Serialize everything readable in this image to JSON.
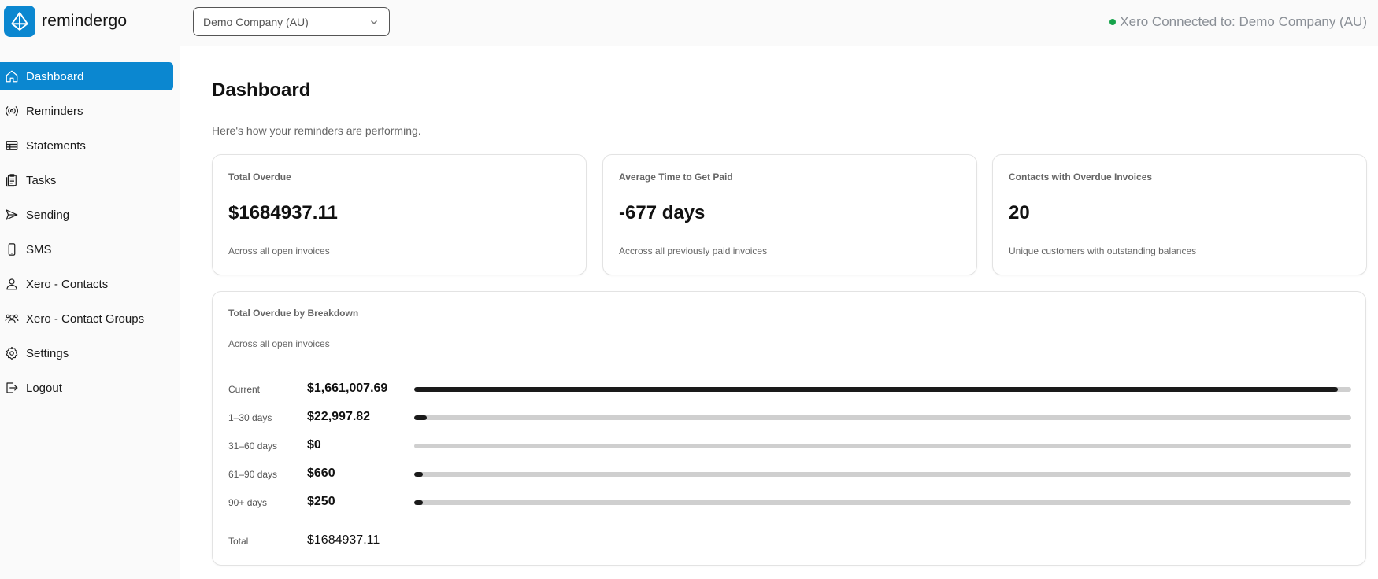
{
  "header": {
    "brand": "remindergo",
    "company_select": {
      "value": "Demo Company (AU)"
    },
    "connection_status": "Xero Connected to: Demo Company (AU)",
    "status_color": "#15a34a"
  },
  "sidebar": {
    "items": [
      {
        "label": "Dashboard",
        "icon": "home-icon",
        "active": true
      },
      {
        "label": "Reminders",
        "icon": "broadcast-icon",
        "active": false
      },
      {
        "label": "Statements",
        "icon": "table-icon",
        "active": false
      },
      {
        "label": "Tasks",
        "icon": "clipboard-icon",
        "active": false
      },
      {
        "label": "Sending",
        "icon": "send-icon",
        "active": false
      },
      {
        "label": "SMS",
        "icon": "phone-icon",
        "active": false
      },
      {
        "label": "Xero - Contacts",
        "icon": "user-icon",
        "active": false
      },
      {
        "label": "Xero - Contact Groups",
        "icon": "users-icon",
        "active": false
      },
      {
        "label": "Settings",
        "icon": "gear-icon",
        "active": false
      },
      {
        "label": "Logout",
        "icon": "logout-icon",
        "active": false
      }
    ]
  },
  "main": {
    "title": "Dashboard",
    "subtitle": "Here's how your reminders are performing.",
    "cards": [
      {
        "title": "Total Overdue",
        "value": "$1684937.11",
        "sub": "Across all open invoices"
      },
      {
        "title": "Average Time to Get Paid",
        "value": "-677 days",
        "sub": "Accross all previously paid invoices"
      },
      {
        "title": "Contacts with Overdue Invoices",
        "value": "20",
        "sub": "Unique customers with outstanding balances"
      }
    ],
    "breakdown": {
      "title": "Total Overdue by Breakdown",
      "sub": "Across all open invoices",
      "rows": [
        {
          "label": "Current",
          "amount": "$1,661,007.69",
          "fraction": 0.9858
        },
        {
          "label": "1–30 days",
          "amount": "$22,997.82",
          "fraction": 0.0136
        },
        {
          "label": "31–60 days",
          "amount": "$0",
          "fraction": 0
        },
        {
          "label": "61–90 days",
          "amount": "$660",
          "fraction": 0.0004
        },
        {
          "label": "90+ days",
          "amount": "$250",
          "fraction": 0.0001
        }
      ],
      "total_label": "Total",
      "total_value": "$1684937.11"
    }
  },
  "colors": {
    "accent": "#0b87d0",
    "bar_fill": "#1a1a1a",
    "bar_track": "#cfcfcf"
  }
}
